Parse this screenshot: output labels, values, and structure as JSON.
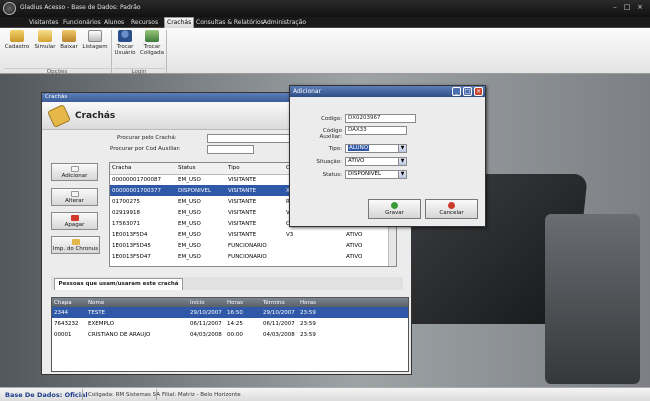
{
  "window": {
    "title": "Gladius Acesso - Base de Dados: Padrão"
  },
  "menu": [
    {
      "label": "Visitantes"
    },
    {
      "label": "Funcionários"
    },
    {
      "label": "Alunos"
    },
    {
      "label": "Recursos"
    },
    {
      "label": "Crachás"
    },
    {
      "label": "Consultas & Relatórios"
    },
    {
      "label": "Administração"
    }
  ],
  "ribbon": {
    "buttons": [
      {
        "label": "Cadastro"
      },
      {
        "label": "Simular"
      },
      {
        "label": "Baixar"
      },
      {
        "label": "Listagem"
      },
      {
        "label": "Trocar Usuário"
      },
      {
        "label": "Trocar Coligada"
      }
    ],
    "groups": [
      {
        "label": "Opções"
      },
      {
        "label": "Login"
      }
    ]
  },
  "cracha_window": {
    "caption": "Crachás",
    "heading": "Crachás",
    "search_label": "Procurar pelo Crachá:",
    "aux_label": "Procurar por Cod Auxiliar:",
    "search_value": "",
    "aux_value": "",
    "side_buttons": [
      {
        "label": "Adicionar"
      },
      {
        "label": "Alterar"
      },
      {
        "label": "Apagar"
      },
      {
        "label": "Imp. do Chronus"
      }
    ],
    "grid": {
      "columns": [
        "Cracha",
        "Status",
        "Tipo",
        "C"
      ],
      "rows": [
        {
          "c": [
            "00000001700087",
            "EM_USO",
            "VISITANTE",
            ""
          ],
          "s": ""
        },
        {
          "c": [
            "00000001700377",
            "DISPONIVEL",
            "VISITANTE",
            "X"
          ],
          "s": ""
        },
        {
          "c": [
            "01700275",
            "EM_USO",
            "VISITANTE",
            "R"
          ],
          "s": ""
        },
        {
          "c": [
            "02919918",
            "EM_USO",
            "VISITANTE",
            "V"
          ],
          "s": ""
        },
        {
          "c": [
            "17563071",
            "EM_USO",
            "VISITANTE",
            "C"
          ],
          "s": ""
        },
        {
          "c": [
            "1E0013F5D4",
            "EM_USO",
            "VISITANTE",
            "V3"
          ],
          "s": "ATIVO"
        },
        {
          "c": [
            "1E0013F5D45",
            "EM_USO",
            "FUNCIONARIO",
            ""
          ],
          "s": "ATIVO"
        },
        {
          "c": [
            "1E0013F5D47",
            "EM_USO",
            "FUNCIONARIO",
            ""
          ],
          "s": "ATIVO"
        }
      ]
    },
    "tab_label": "Pessoas que usam/usaram este crachá",
    "people": {
      "columns": [
        "Chapa",
        "Nome",
        "Início",
        "Horas",
        "Término",
        "Horas"
      ],
      "rows": [
        [
          "2344",
          "TESTE",
          "29/10/2007",
          "16:50",
          "29/10/2007",
          "23:59"
        ],
        [
          "7643232",
          "EXEMPLO",
          "06/11/2007",
          "14:25",
          "06/11/2007",
          "23:59"
        ],
        [
          "00001",
          "CRISTIANO DE ARAUJO",
          "04/03/2008",
          "00:00",
          "04/03/2008",
          "23:59"
        ]
      ]
    }
  },
  "add_dialog": {
    "caption": "Adicionar",
    "codigo_label": "Codigo:",
    "codigo_value": "DX0203967",
    "aux_label": "Código Auxiliar:",
    "aux_value": "DAX33",
    "tipo_label": "Tipo:",
    "tipo_value": "ALUNO",
    "situacao_label": "Situação:",
    "situacao_value": "ATIVO",
    "status_label": "Status:",
    "status_value": "DISPONIVEL",
    "ok_label": "Gravar",
    "cancel_label": "Cancelar"
  },
  "status_bar": {
    "db": "Base De Dados: Oficial",
    "coligada": "Coligada: RM Sistemas SA",
    "filial": "Filial: Matriz - Belo Horizonte"
  },
  "colors": {
    "accent": "#2f59a8",
    "caption": "#3a5c99"
  }
}
